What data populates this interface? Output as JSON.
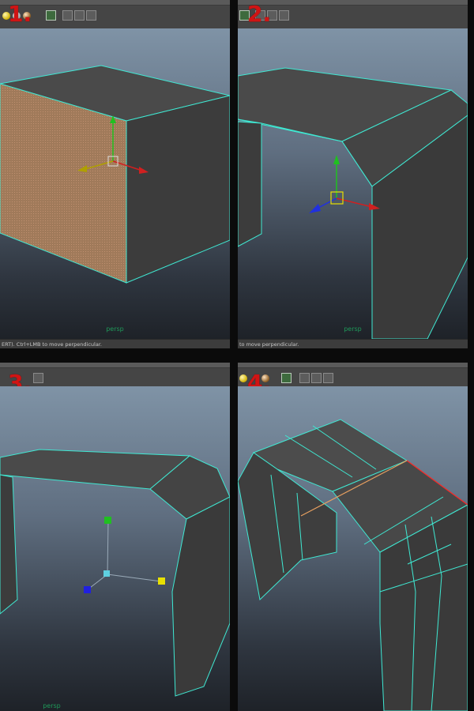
{
  "steps": [
    "1.",
    "2.",
    "3.",
    "4."
  ],
  "viewport_label": "persp",
  "help_lines": {
    "panel1": "ERT).  Ctrl+LMB to move perpendicular.",
    "panel2": "to move perpendicular."
  },
  "icons": [
    "yellow-light-orb",
    "white-light-orb",
    "shaded-orb",
    "select-tool",
    "cube",
    "duplicate",
    "share"
  ],
  "colors": {
    "wireframe": "#3fe8d2",
    "selected_face": "#b08060",
    "axis_x": "#d02020",
    "axis_y": "#20c020",
    "axis_z": "#2030e0",
    "selected_edge": "#ff2020",
    "edge_loop": "#e8a060"
  }
}
